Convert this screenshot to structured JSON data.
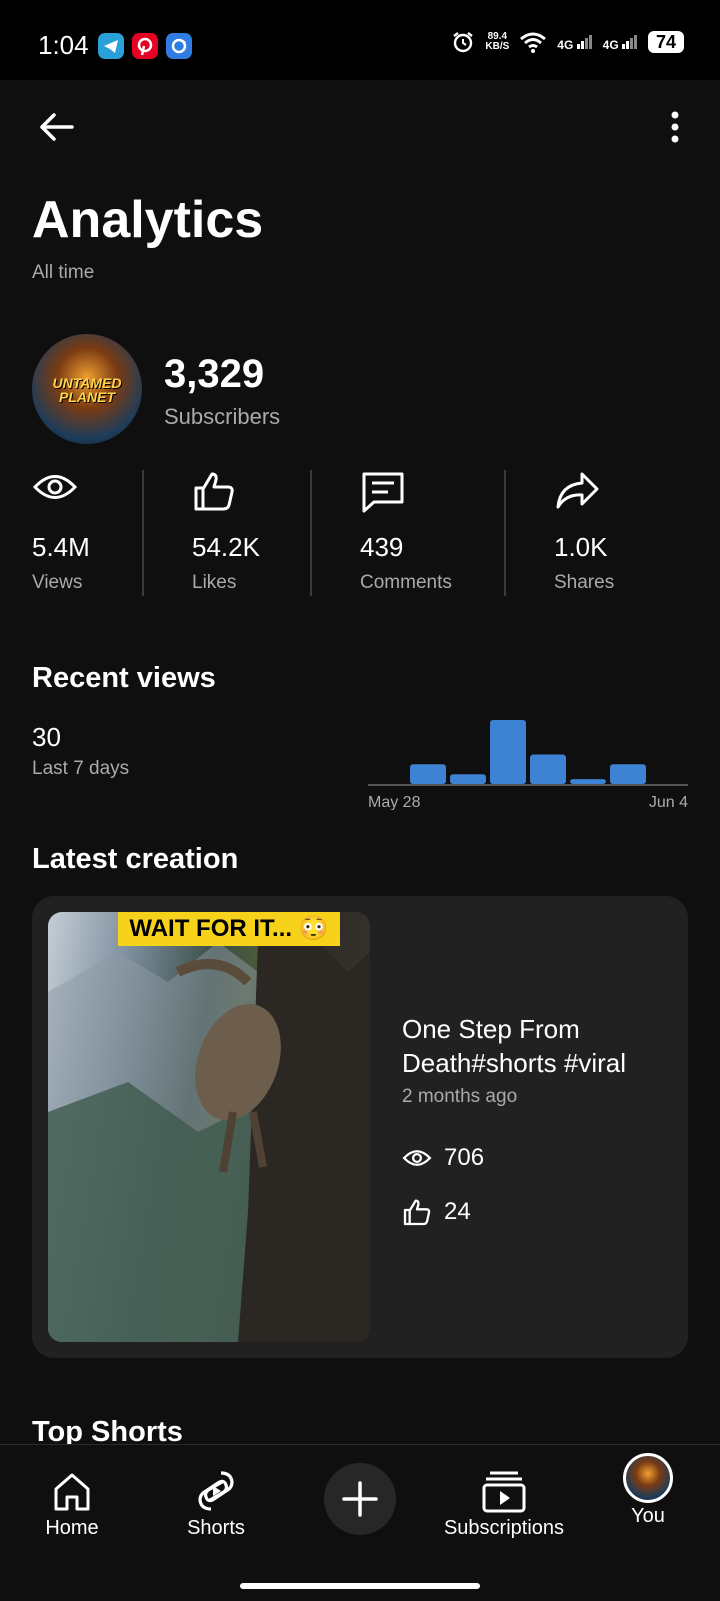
{
  "status": {
    "time": "1:04",
    "net_speed_value": "89.4",
    "net_speed_unit": "KB/S",
    "network_a": "4G",
    "network_b": "4G",
    "battery": "74"
  },
  "header": {
    "title": "Analytics",
    "subtitle": "All time"
  },
  "channel": {
    "avatar_text_line1": "UNTAMED",
    "avatar_text_line2": "PLANET",
    "subscribers": "3,329",
    "subscribers_label": "Subscribers"
  },
  "stats": [
    {
      "icon": "eye-icon",
      "value": "5.4M",
      "label": "Views"
    },
    {
      "icon": "thumbs-up-icon",
      "value": "54.2K",
      "label": "Likes"
    },
    {
      "icon": "comment-icon",
      "value": "439",
      "label": "Comments"
    },
    {
      "icon": "share-icon",
      "value": "1.0K",
      "label": "Shares"
    }
  ],
  "recent_views": {
    "title": "Recent views",
    "value": "30",
    "label": "Last 7 days"
  },
  "chart_data": {
    "type": "bar",
    "categories": [
      "May 28",
      "May 29",
      "May 30",
      "May 31",
      "Jun 1",
      "Jun 2",
      "Jun 3",
      "Jun 4"
    ],
    "values": [
      0,
      4,
      2,
      13,
      6,
      1,
      4,
      0
    ],
    "x_tick_labels": [
      "May 28",
      "Jun 4"
    ],
    "title": "",
    "xlabel": "",
    "ylabel": "",
    "ylim": [
      0,
      13
    ],
    "grid": false,
    "bar_color": "#3e82d4"
  },
  "latest": {
    "title": "Latest creation",
    "thumb_banner": "WAIT FOR IT... 😳",
    "video_title_line1": "One Step From",
    "video_title_line2": "Death#shorts #viral",
    "age": "2 months ago",
    "views": "706",
    "likes": "24"
  },
  "top_shorts": {
    "title": "Top Shorts"
  },
  "nav": {
    "home": "Home",
    "shorts": "Shorts",
    "subscriptions": "Subscriptions",
    "you": "You"
  },
  "colors": {
    "background": "#0f0f0f",
    "card": "#212121",
    "accent_blue": "#3e82d4",
    "text_secondary": "#aaaaaa"
  }
}
